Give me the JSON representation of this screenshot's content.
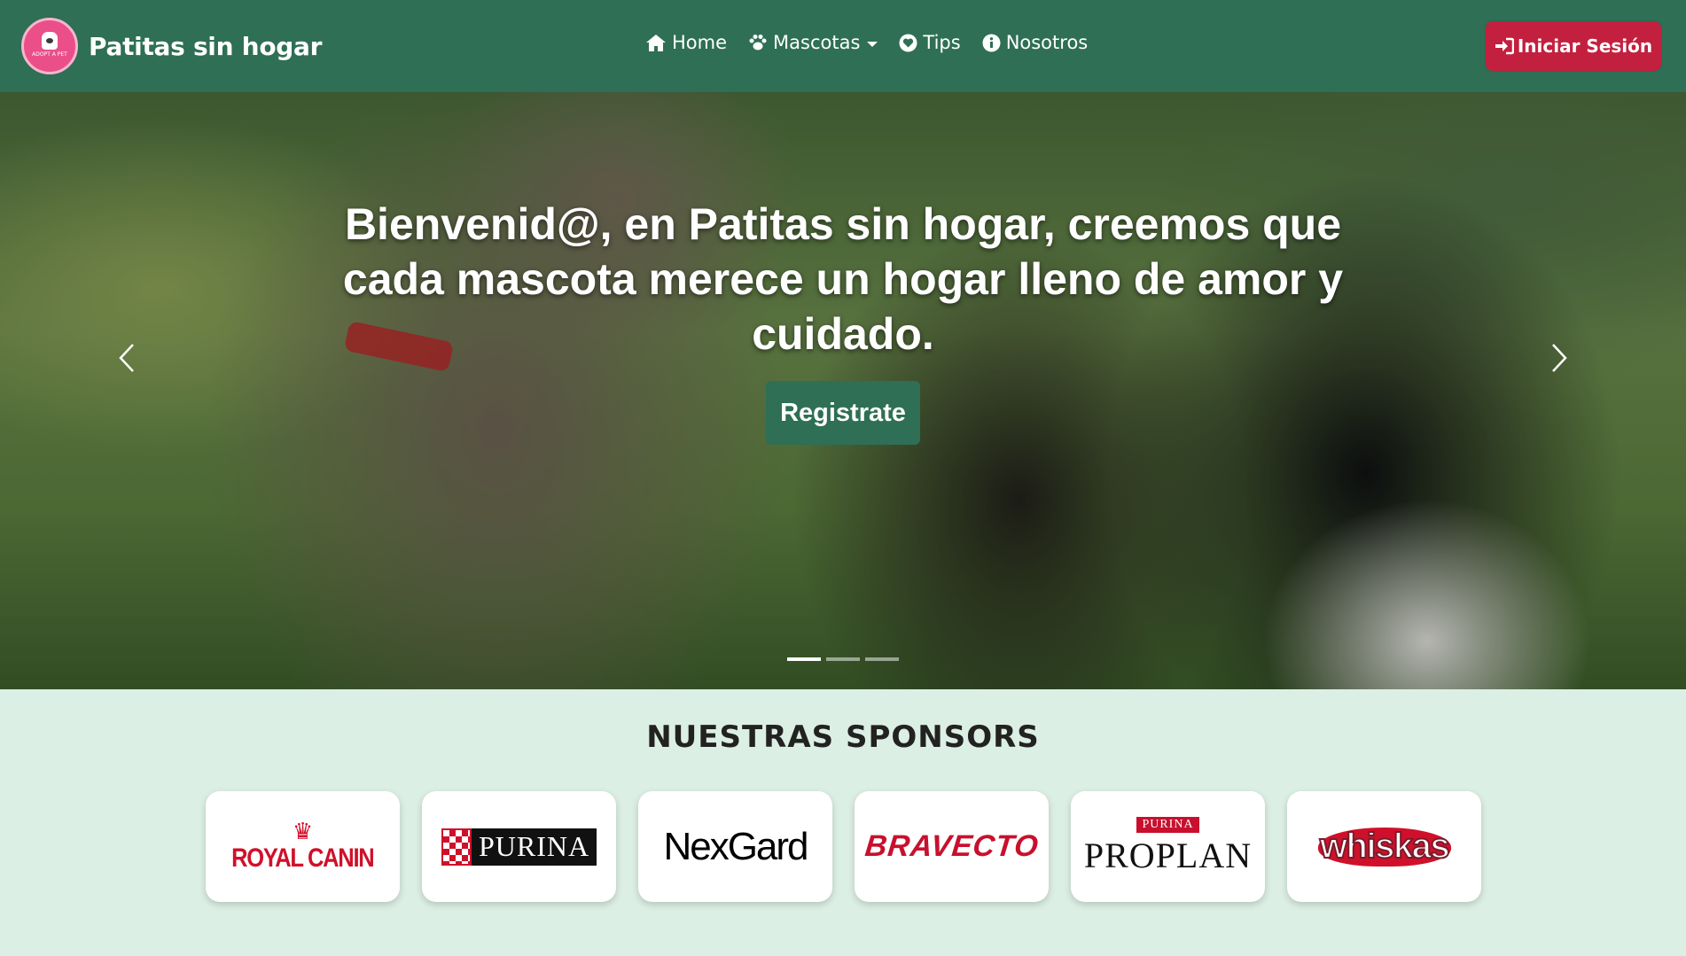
{
  "brand": {
    "name": "Patitas sin hogar",
    "logo_text": "ADOPT A PET",
    "primary_color": "#2e6f55",
    "accent_color": "#c3203f"
  },
  "nav": {
    "items": [
      {
        "label": "Home",
        "icon": "home-icon"
      },
      {
        "label": "Mascotas",
        "icon": "paw-icon",
        "dropdown": true
      },
      {
        "label": "Tips",
        "icon": "heart-icon"
      },
      {
        "label": "Nosotros",
        "icon": "info-icon"
      }
    ],
    "login_label": "Iniciar Sesión"
  },
  "hero": {
    "title": "Bienvenid@, en Patitas sin hogar, creemos que cada mascota merece un hogar lleno de amor y cuidado.",
    "cta_label": "Registrate",
    "slides": 3,
    "active_slide": 1
  },
  "sponsors": {
    "title": "NUESTRAS SPONSORS",
    "items": [
      {
        "name": "ROYAL CANIN"
      },
      {
        "name": "PURINA"
      },
      {
        "name": "NexGard"
      },
      {
        "name": "BRAVECTO"
      },
      {
        "name": "PROPLAN",
        "top": "PURINA"
      },
      {
        "name": "whiskas"
      }
    ]
  }
}
